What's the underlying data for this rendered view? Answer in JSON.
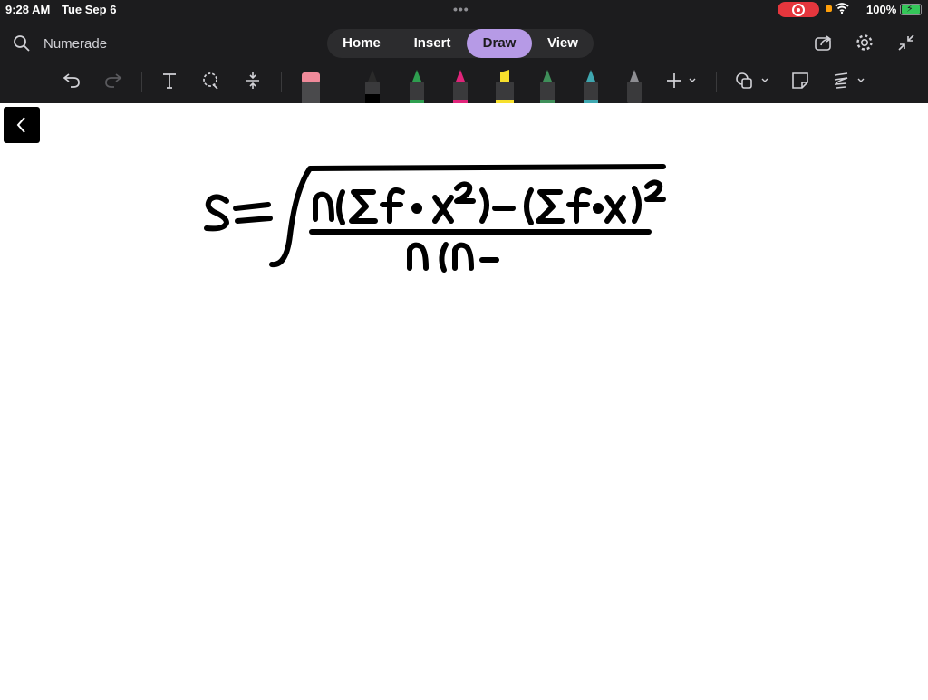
{
  "status_bar": {
    "time": "9:28 AM",
    "date": "Tue Sep 6",
    "battery": "100%",
    "dots": "•••"
  },
  "header": {
    "app_name": "Numerade",
    "tabs": [
      {
        "label": "Home",
        "active": false
      },
      {
        "label": "Insert",
        "active": false
      },
      {
        "label": "Draw",
        "active": true
      },
      {
        "label": "View",
        "active": false
      }
    ],
    "right_icons": [
      "share-icon",
      "gear-icon",
      "collapse-icon"
    ]
  },
  "toolbar": {
    "tools": [
      "undo-icon",
      "redo-icon",
      "text-tool-icon",
      "lasso-icon",
      "insert-space-icon",
      "eraser-icon"
    ],
    "pens": [
      {
        "name": "black-pen",
        "color": "#1a1a1a",
        "selected": true
      },
      {
        "name": "green-pen",
        "color": "#2e9e4f",
        "selected": false
      },
      {
        "name": "magenta-pen",
        "color": "#e0247a",
        "selected": false
      },
      {
        "name": "yellow-highlighter",
        "color": "#f7e02c",
        "selected": false
      },
      {
        "name": "olive-green-pen",
        "color": "#3f8f5a",
        "selected": false
      },
      {
        "name": "teal-pen",
        "color": "#3fa7b0",
        "selected": false
      },
      {
        "name": "grey-pen",
        "color": "#8e8e93",
        "selected": false
      }
    ],
    "extra": [
      "add-pen-icon",
      "shapes-icon",
      "sticky-note-icon",
      "ink-to-text-icon"
    ]
  },
  "colors": {
    "toolbar_bg": "#1c1c1e",
    "active_tab": "#b69ae6",
    "record": "#e5363d",
    "ink": "#000000"
  },
  "canvas": {
    "handwriting": "s = √( n(Σf·x²) − (Σf·x)² / n(n− )"
  }
}
